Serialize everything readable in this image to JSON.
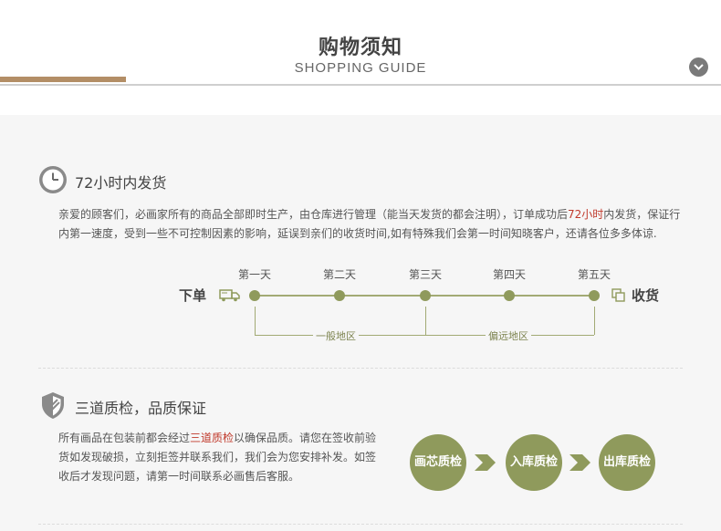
{
  "header": {
    "title_cn": "购物须知",
    "title_en": "SHOPPING GUIDE",
    "toggle_icon": "chevron-down-icon"
  },
  "colors": {
    "accent_brown": "#b38e66",
    "olive": "#8f9a5c",
    "highlight_red": "#c0392b",
    "panel_bg": "#f6f6f6"
  },
  "delivery": {
    "icon": "clock-icon",
    "title": "72小时内发货",
    "para_before": "亲爱的顾客们，必画家所有的商品全部即时生产，由仓库进行管理（能当天发货的都会注明），订单成功后",
    "para_highlight": "72小时",
    "para_after": "内发货，保证行内第一速度，受到一些不可控制因素的影响，延误到亲们的收货时间,如有特殊我们会第一时间知晓客户，还请各位多多体谅.",
    "timeline": {
      "start_label": "下单",
      "start_icon": "truck-icon",
      "end_label": "收货",
      "end_icon": "package-icon",
      "days": [
        "第一天",
        "第二天",
        "第三天",
        "第四天",
        "第五天"
      ],
      "regions": [
        "一般地区",
        "偏远地区"
      ]
    }
  },
  "quality": {
    "icon": "shield-icon",
    "title": "三道质检，品质保证",
    "para_before": "所有画品在包装前都会经过",
    "para_highlight": "三道质检",
    "para_after": "以确保品质。请您在签收前验货如发现破损，立刻拒签并联系我们，我们会为您安排补发。如签收后才发现问题，请第一时间联系必画售后客服。",
    "steps": [
      "画芯质检",
      "入库质检",
      "出库质检"
    ],
    "step_arrow_icon": "double-chevron-right-icon"
  }
}
